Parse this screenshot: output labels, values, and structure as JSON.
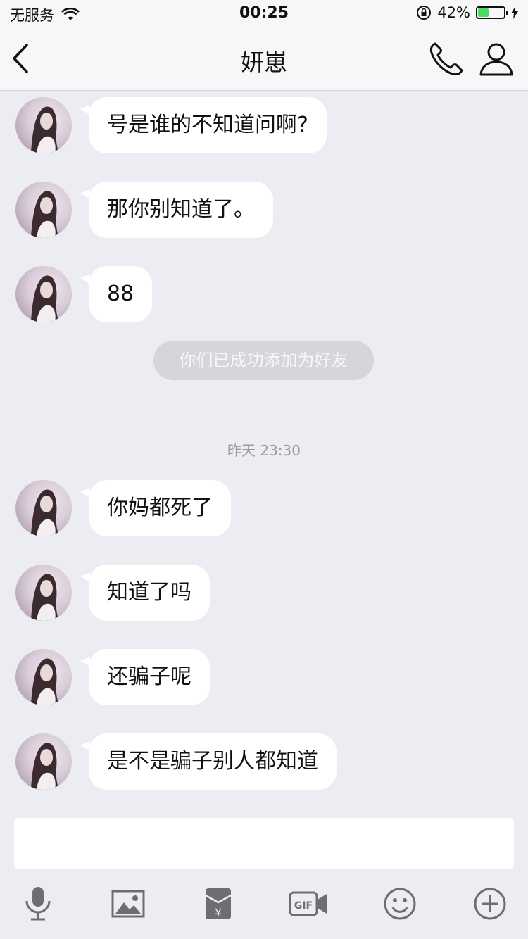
{
  "status_bar": {
    "carrier": "无服务",
    "time": "00:25",
    "battery": "42%",
    "battery_level": 0.42
  },
  "nav": {
    "title": "妍崽"
  },
  "messages": [
    {
      "text": "号是谁的不知道问啊?"
    },
    {
      "text": "那你别知道了。"
    },
    {
      "text": "88"
    },
    {
      "text": "你妈都死了"
    },
    {
      "text": "知道了吗"
    },
    {
      "text": "还骗子呢"
    },
    {
      "text": "是不是骗子别人都知道"
    }
  ],
  "system_message": "你们已成功添加为好友",
  "time_label": "昨天 23:30",
  "input": {
    "value": ""
  },
  "toolbar": {
    "icons": [
      "microphone-icon",
      "image-icon",
      "red-packet-icon",
      "gif-icon",
      "emoji-icon",
      "plus-icon"
    ]
  }
}
